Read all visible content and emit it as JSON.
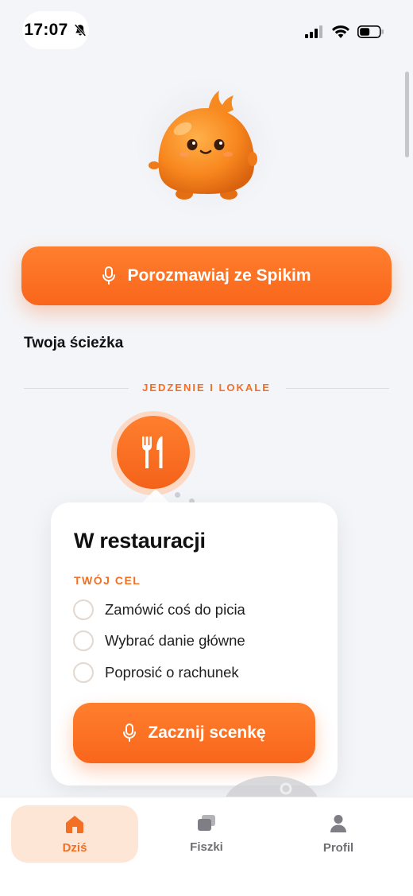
{
  "status_bar": {
    "time": "17:07",
    "icons": [
      "bell-slash-icon",
      "signal-icon",
      "wifi-icon",
      "battery-icon"
    ]
  },
  "mascot": {
    "icon": "spiki-mascot-icon"
  },
  "main_cta": {
    "label": "Porozmawiaj ze Spikim",
    "icon": "microphone-icon"
  },
  "path": {
    "title": "Twoja ścieżka",
    "section_label": "JEDZENIE I LOKALE",
    "node_icon": "fork-knife-icon"
  },
  "lesson_card": {
    "title": "W restauracji",
    "goal_label": "TWÓJ CEL",
    "goals": [
      "Zamówić coś do picia",
      "Wybrać danie główne",
      "Poprosić o rachunek"
    ],
    "start_label": "Zacznij scenkę"
  },
  "tabs": [
    {
      "label": "Dziś",
      "icon": "home-icon",
      "active": true
    },
    {
      "label": "Fiszki",
      "icon": "flashcards-icon",
      "active": false
    },
    {
      "label": "Profil",
      "icon": "profile-icon",
      "active": false
    }
  ],
  "colors": {
    "accent": "#f9661b",
    "accent_light": "#fde6d6",
    "background": "#f4f5f8"
  }
}
